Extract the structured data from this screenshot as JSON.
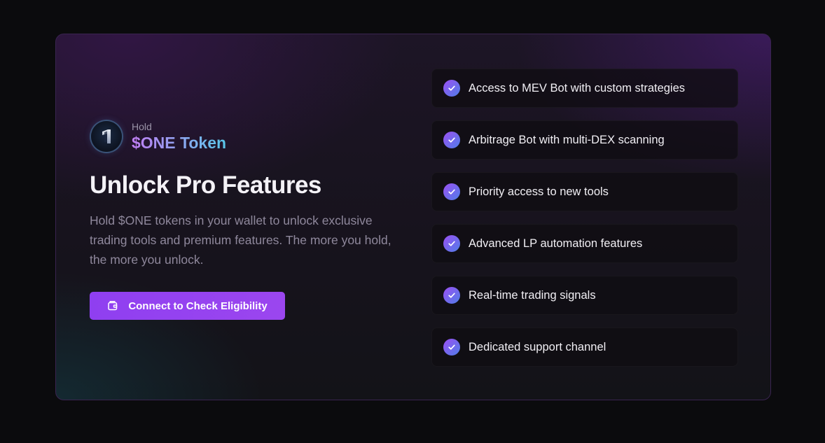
{
  "brand": {
    "prefix": "Hold",
    "token_name": "$ONE Token",
    "logo_icon": "one-token-logo-icon"
  },
  "hero": {
    "title": "Unlock Pro Features",
    "description": "Hold $ONE tokens in your wallet to unlock exclusive trading tools and premium features. The more you hold, the more you unlock."
  },
  "cta": {
    "label": "Connect to Check Eligibility",
    "icon": "wallet-icon"
  },
  "features": [
    {
      "label": "Access to MEV Bot with custom strategies",
      "icon": "check-icon"
    },
    {
      "label": "Arbitrage Bot with multi-DEX scanning",
      "icon": "check-icon"
    },
    {
      "label": "Priority access to new tools",
      "icon": "check-icon"
    },
    {
      "label": "Advanced LP automation features",
      "icon": "check-icon"
    },
    {
      "label": "Real-time trading signals",
      "icon": "check-icon"
    },
    {
      "label": "Dedicated support channel",
      "icon": "check-icon"
    }
  ],
  "colors": {
    "background": "#0b0b0d",
    "accent_purple": "#9b46ef",
    "accent_cyan": "#58c6e8",
    "heading_text": "#f4f2f7",
    "muted_text": "#8f889c"
  }
}
